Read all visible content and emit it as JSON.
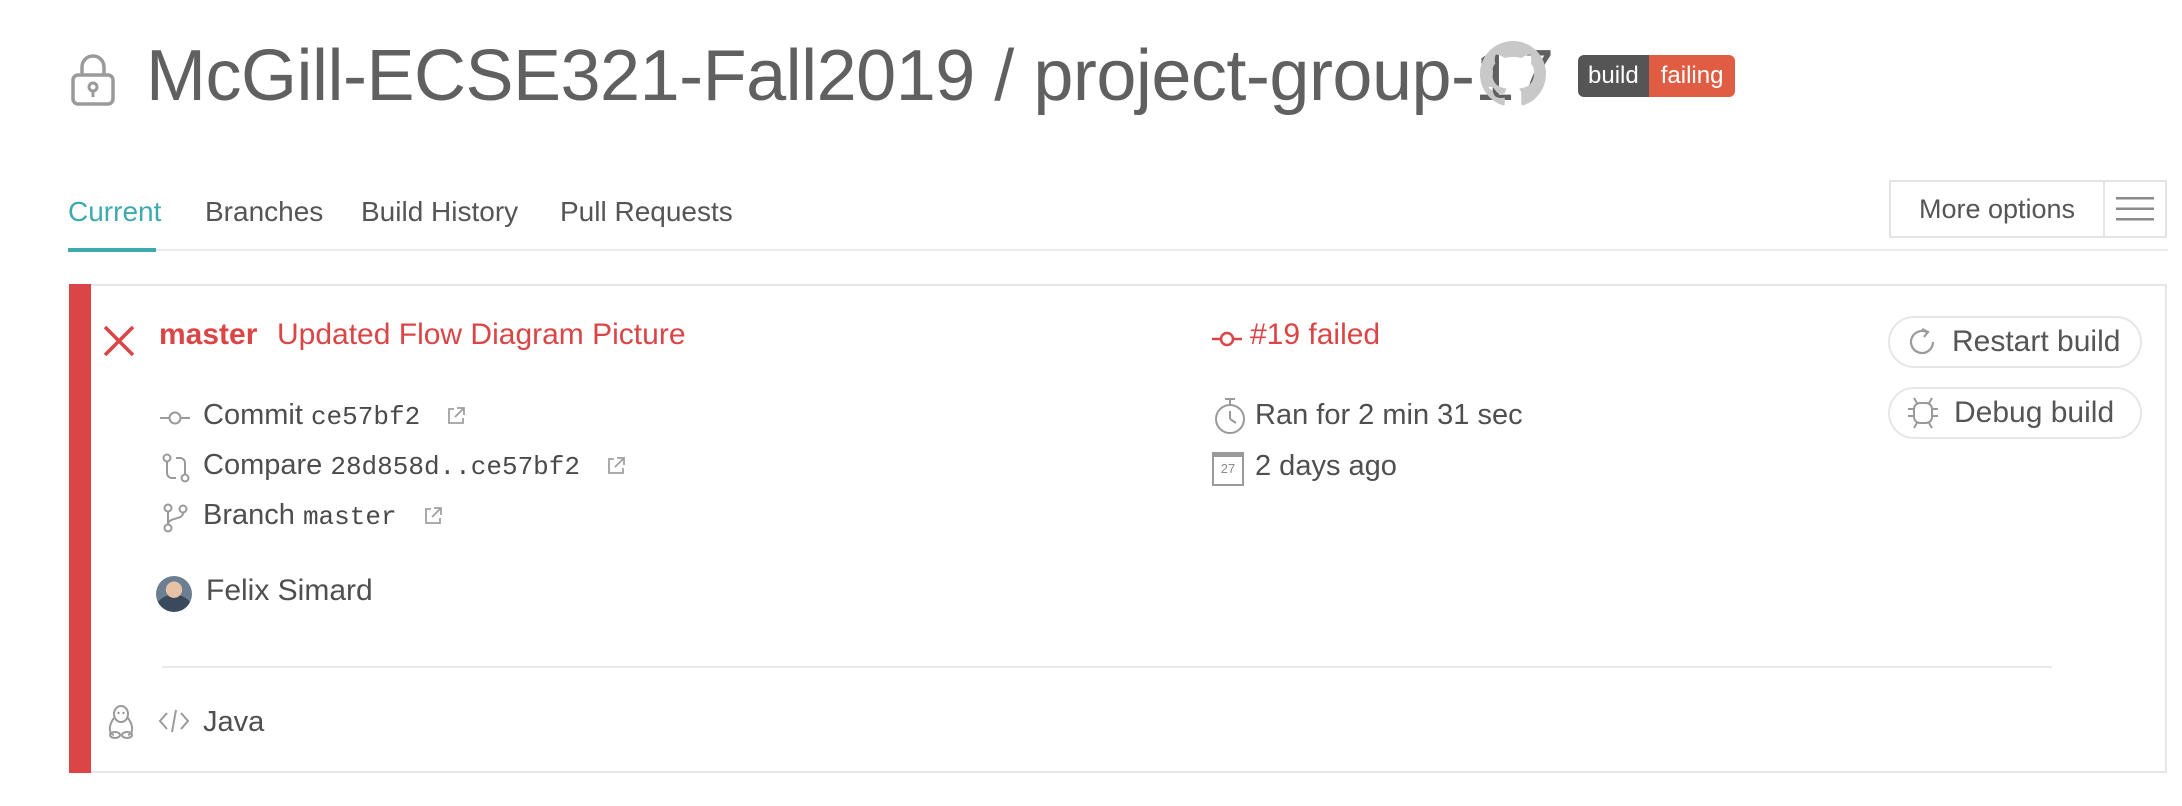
{
  "header": {
    "repo_title": "McGill-ECSE321-Fall2019 / project-group-17",
    "badge": {
      "left": "build",
      "right": "failing"
    }
  },
  "tabs": [
    {
      "label": "Current",
      "active": true
    },
    {
      "label": "Branches"
    },
    {
      "label": "Build History"
    },
    {
      "label": "Pull Requests"
    }
  ],
  "more_options": {
    "label": "More options"
  },
  "build": {
    "branch": "master",
    "commit_message": "Updated Flow Diagram Picture",
    "status_text": "#19 failed",
    "commit": {
      "label": "Commit",
      "value": "ce57bf2"
    },
    "compare": {
      "label": "Compare",
      "value": "28d858d..ce57bf2"
    },
    "branch_row": {
      "label": "Branch",
      "value": "master"
    },
    "duration": "Ran for 2 min 31 sec",
    "time_ago": "2 days ago",
    "calendar_day": "27",
    "author": "Felix Simard",
    "language": "Java"
  },
  "actions": {
    "restart": "Restart build",
    "debug": "Debug build"
  },
  "colors": {
    "failed_red": "#db4545",
    "accent_teal": "#3eaaaf",
    "badge_dark": "#555555",
    "badge_fail": "#e05d44"
  }
}
